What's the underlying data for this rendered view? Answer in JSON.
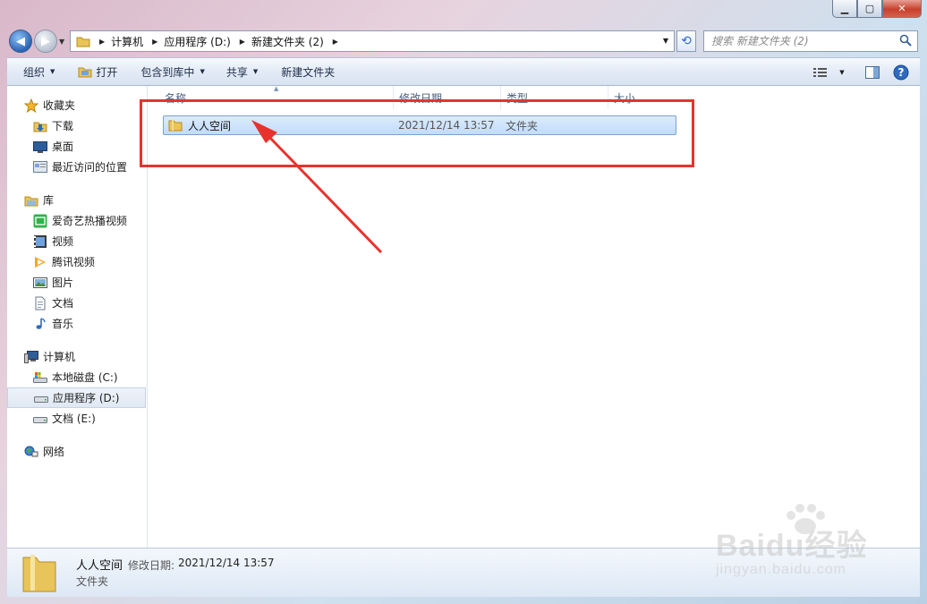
{
  "address": {
    "crumbs": [
      "计算机",
      "应用程序 (D:)",
      "新建文件夹 (2)"
    ]
  },
  "search": {
    "placeholder": "搜索 新建文件夹 (2)"
  },
  "toolbar": {
    "organize": "组织",
    "open": "打开",
    "include_library": "包含到库中",
    "share": "共享",
    "new_folder": "新建文件夹"
  },
  "sidebar": {
    "favorites": {
      "label": "收藏夹",
      "items": [
        "下载",
        "桌面",
        "最近访问的位置"
      ]
    },
    "libraries": {
      "label": "库",
      "items": [
        "爱奇艺热播视频",
        "视频",
        "腾讯视频",
        "图片",
        "文档",
        "音乐"
      ]
    },
    "computer": {
      "label": "计算机",
      "items": [
        "本地磁盘 (C:)",
        "应用程序 (D:)",
        "文档 (E:)"
      ]
    },
    "network": {
      "label": "网络"
    }
  },
  "columns": [
    "名称",
    "修改日期",
    "类型",
    "大小"
  ],
  "files": [
    {
      "name": "人人空间",
      "modified": "2021/12/14 13:57",
      "type": "文件夹",
      "size": ""
    }
  ],
  "details": {
    "name": "人人空间",
    "modified_label": "修改日期:",
    "modified_value": "2021/12/14 13:57",
    "type": "文件夹"
  },
  "watermark": {
    "brand": "Baidu经验",
    "url": "jingyan.baidu.com"
  },
  "colors": {
    "annotation": "#e8322d",
    "selection": "#c1dcfc",
    "folder": "#e9c45a"
  },
  "selected_nav": "应用程序 (D:)"
}
